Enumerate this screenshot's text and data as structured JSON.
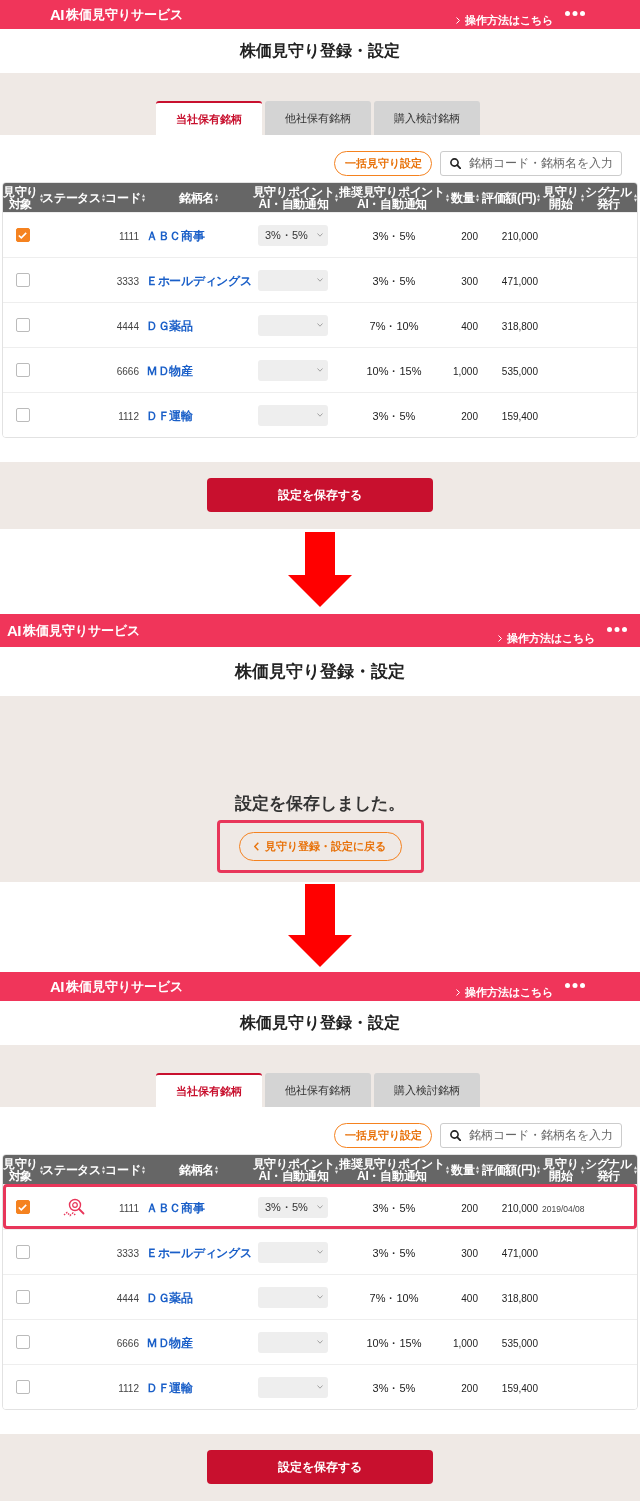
{
  "steps": [
    {
      "kind": "settings",
      "header": {
        "logo_mark": "AI",
        "service_name": "株価見守りサービス",
        "help_link": "操作方法はこちら"
      },
      "title": "株価見守り登録・設定",
      "tabs": [
        {
          "label": "当社保有銘柄",
          "selected": true
        },
        {
          "label": "他社保有銘柄",
          "selected": false
        },
        {
          "label": "購入検討銘柄",
          "selected": false
        }
      ],
      "bulk_button": "一括見守り設定",
      "search": {
        "placeholder": "銘柄コード・銘柄名を入力"
      },
      "table": {
        "columns": [
          "見守り対象",
          "ステータス",
          "コード",
          "銘柄名",
          "見守りポイント\nAI・自動通知",
          "推奨見守りポイント\nAI・自動通知",
          "数量",
          "評価額(円)",
          "見守り開始",
          "シグナル発行"
        ],
        "rows": [
          {
            "checked": true,
            "watching": false,
            "highlighted": false,
            "code": "1111",
            "name": "ＡＢＣ商事",
            "point": "3%・5%",
            "recommended": "3%・5%",
            "quantity": "200",
            "value": "210,000"
          },
          {
            "checked": false,
            "watching": false,
            "highlighted": false,
            "code": "3333",
            "name": "Ｅホールディングス",
            "recommended": "3%・5%",
            "quantity": "300",
            "value": "471,000"
          },
          {
            "checked": false,
            "watching": false,
            "highlighted": false,
            "code": "4444",
            "name": "ＤＧ薬品",
            "recommended": "7%・10%",
            "quantity": "400",
            "value": "318,800"
          },
          {
            "checked": false,
            "watching": false,
            "highlighted": false,
            "code": "6666",
            "name": "ＭＤ物産",
            "recommended": "10%・15%",
            "quantity": "1,000",
            "value": "535,000"
          },
          {
            "checked": false,
            "watching": false,
            "highlighted": false,
            "code": "1112",
            "name": "ＤＦ運輸",
            "recommended": "3%・5%",
            "quantity": "200",
            "value": "159,400"
          }
        ]
      },
      "save_button": "設定を保存する"
    },
    {
      "kind": "message",
      "header": {
        "logo_mark": "AI",
        "service_name": "株価見守りサービス",
        "help_link": "操作方法はこちら"
      },
      "title": "株価見守り登録・設定",
      "message": "設定を保存しました。",
      "back_button": {
        "label": "見守り登録・設定に戻る",
        "highlighted": true
      }
    },
    {
      "kind": "settings",
      "header": {
        "logo_mark": "AI",
        "service_name": "株価見守りサービス",
        "help_link": "操作方法はこちら"
      },
      "title": "株価見守り登録・設定",
      "tabs": [
        {
          "label": "当社保有銘柄",
          "selected": true
        },
        {
          "label": "他社保有銘柄",
          "selected": false
        },
        {
          "label": "購入検討銘柄",
          "selected": false
        }
      ],
      "bulk_button": "一括見守り設定",
      "search": {
        "placeholder": "銘柄コード・銘柄名を入力"
      },
      "table": {
        "columns": [
          "見守り対象",
          "ステータス",
          "コード",
          "銘柄名",
          "見守りポイント\nAI・自動通知",
          "推奨見守りポイント\nAI・自動通知",
          "数量",
          "評価額(円)",
          "見守り開始",
          "シグナル発行"
        ],
        "rows": [
          {
            "checked": true,
            "watching": true,
            "highlighted": true,
            "code": "1111",
            "name": "ＡＢＣ商事",
            "point": "3%・5%",
            "recommended": "3%・5%",
            "quantity": "200",
            "value": "210,000",
            "start": "2019/04/08"
          },
          {
            "checked": false,
            "watching": false,
            "highlighted": false,
            "code": "3333",
            "name": "Ｅホールディングス",
            "recommended": "3%・5%",
            "quantity": "300",
            "value": "471,000"
          },
          {
            "checked": false,
            "watching": false,
            "highlighted": false,
            "code": "4444",
            "name": "ＤＧ薬品",
            "recommended": "7%・10%",
            "quantity": "400",
            "value": "318,800"
          },
          {
            "checked": false,
            "watching": false,
            "highlighted": false,
            "code": "6666",
            "name": "ＭＤ物産",
            "recommended": "10%・15%",
            "quantity": "1,000",
            "value": "535,000"
          },
          {
            "checked": false,
            "watching": false,
            "highlighted": false,
            "code": "1112",
            "name": "ＤＦ運輸",
            "recommended": "3%・5%",
            "quantity": "200",
            "value": "159,400"
          }
        ]
      },
      "save_button": "設定を保存する"
    }
  ]
}
